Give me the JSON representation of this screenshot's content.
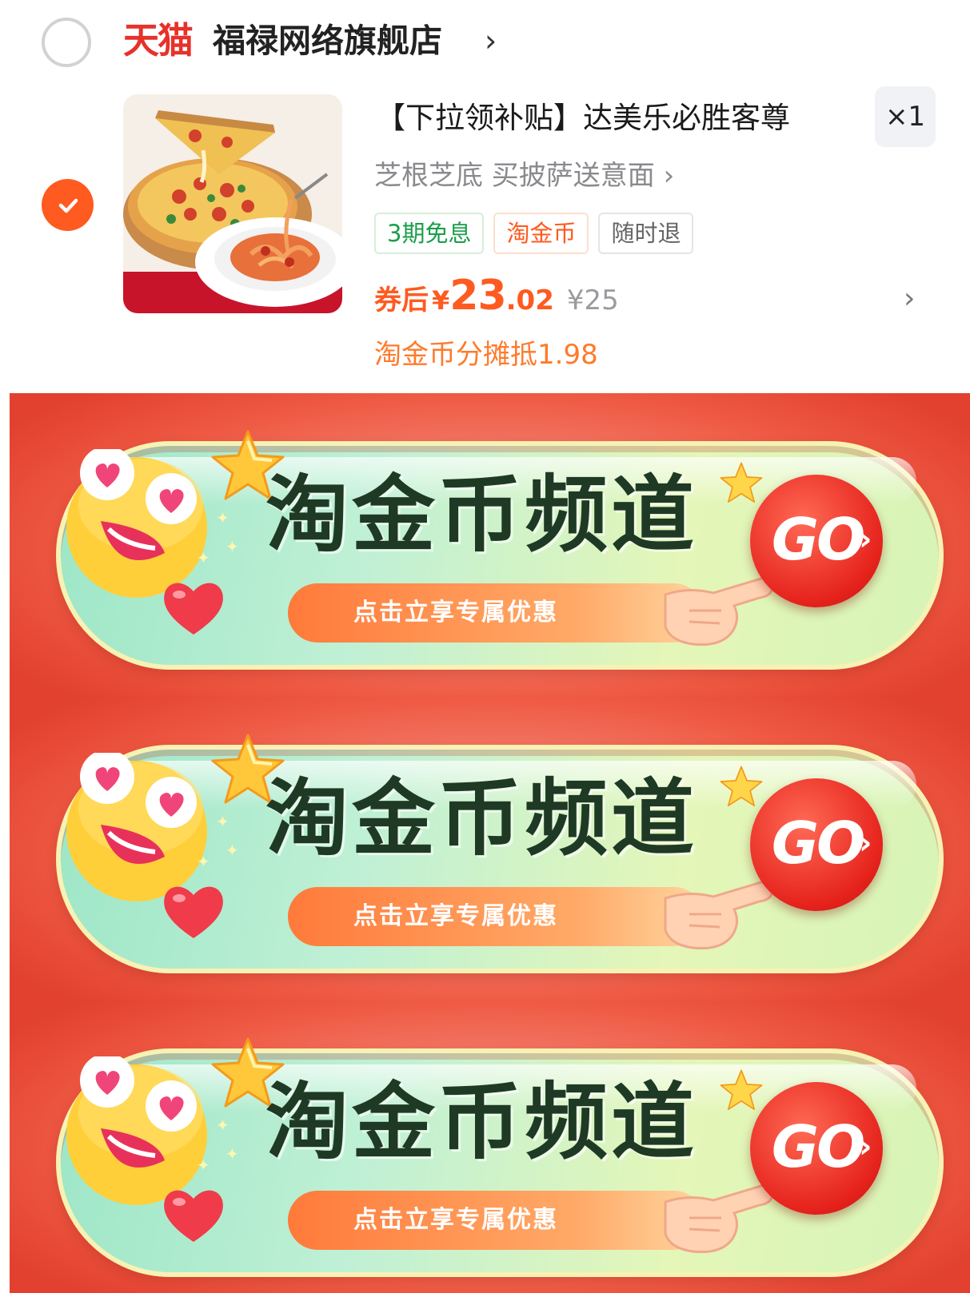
{
  "shop": {
    "platform_logo": "天猫",
    "name": "福禄网络旗舰店",
    "chevron": "›"
  },
  "item": {
    "title": "【下拉领补贴】达美乐必胜客尊",
    "sku": "芝根芝底 买披萨送意面 ›",
    "quantity": "×1",
    "tags": [
      "3期免息",
      "淘金币",
      "随时退"
    ],
    "price_label": "券后",
    "price_yen": "¥",
    "price_int": "23",
    "price_dec": ".02",
    "original_price": "¥25",
    "row_chevron": "›",
    "note": "淘金币分摊抵1.98",
    "checked": true
  },
  "banners": [
    {
      "title": "淘金币频道",
      "subtitle": "点击立享专属优惠",
      "button": "GO"
    },
    {
      "title": "淘金币频道",
      "subtitle": "点击立享专属优惠",
      "button": "GO"
    },
    {
      "title": "淘金币频道",
      "subtitle": "点击立享专属优惠",
      "button": "GO"
    }
  ],
  "colors": {
    "accent": "#ff5a1f",
    "tmall_red": "#e6322a",
    "banner_red": "#ef5b45",
    "go_red": "#e5221c"
  },
  "icons": [
    "radio-unchecked-icon",
    "checkmark-icon",
    "chevron-right-icon",
    "star-icon",
    "heart-icon",
    "emoji-heart-eyes-icon",
    "pointing-hand-icon"
  ]
}
